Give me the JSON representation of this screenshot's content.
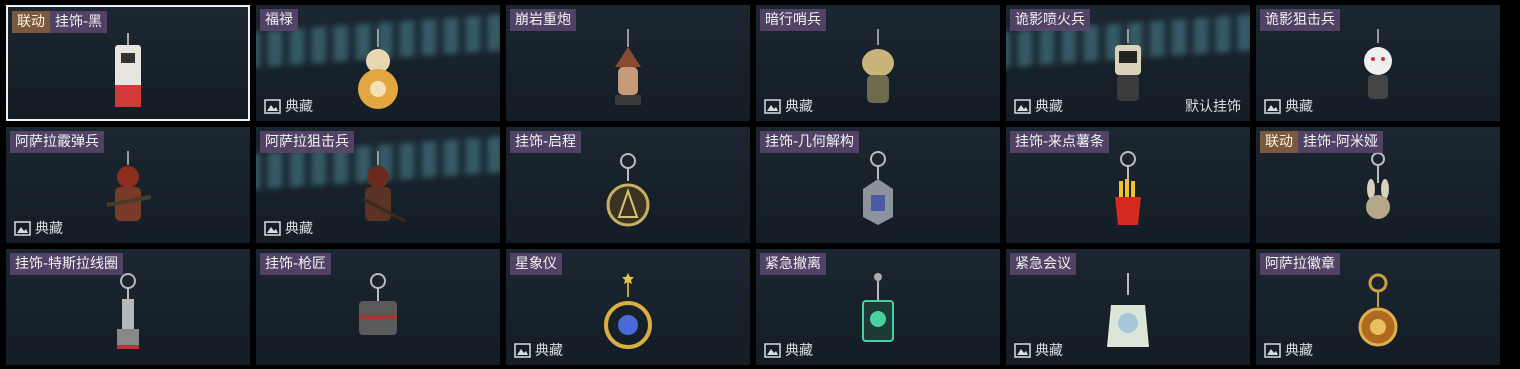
{
  "items": [
    {
      "collab": "联动",
      "name": "挂饰-黑",
      "selected": true,
      "icon": "black-charm-icon"
    },
    {
      "name": "福禄",
      "rarity": "典藏",
      "streak": true,
      "icon": "round-robot-charm-icon"
    },
    {
      "name": "崩岩重炮",
      "icon": "helmet-figure-charm-icon"
    },
    {
      "name": "暗行哨兵",
      "rarity": "典藏",
      "icon": "camo-figure-charm-icon"
    },
    {
      "name": "诡影喷火兵",
      "rarity": "典藏",
      "default_label": "默认挂饰",
      "streak": true,
      "icon": "flamethrower-figure-charm-icon"
    },
    {
      "name": "诡影狙击兵",
      "rarity": "典藏",
      "icon": "mask-figure-charm-icon"
    },
    {
      "name": "阿萨拉霰弹兵",
      "rarity": "典藏",
      "icon": "shotgunner-figure-charm-icon"
    },
    {
      "name": "阿萨拉狙击兵",
      "rarity": "典藏",
      "streak": true,
      "icon": "sniper-figure-charm-icon"
    },
    {
      "name": "挂饰-启程",
      "icon": "compass-medal-charm-icon"
    },
    {
      "name": "挂饰-几何解构",
      "icon": "geometric-shield-charm-icon"
    },
    {
      "name": "挂饰-来点薯条",
      "icon": "fries-charm-icon"
    },
    {
      "collab": "联动",
      "name": "挂饰-阿米娅",
      "icon": "bunny-charm-icon"
    },
    {
      "name": "挂饰-特斯拉线圈",
      "icon": "tesla-coil-charm-icon"
    },
    {
      "name": "挂饰-枪匠",
      "icon": "toolbox-charm-icon"
    },
    {
      "name": "星象仪",
      "rarity": "典藏",
      "icon": "orrery-charm-icon"
    },
    {
      "name": "紧急撤离",
      "rarity": "典藏",
      "icon": "green-tag-charm-icon"
    },
    {
      "name": "紧急会议",
      "rarity": "典藏",
      "icon": "meeting-badge-charm-icon"
    },
    {
      "name": "阿萨拉徽章",
      "rarity": "典藏",
      "icon": "asala-badge-charm-icon"
    }
  ],
  "colors": {
    "card_bg": "#1b2630",
    "collab_tag": "#7a5a3e",
    "name_tag": "#5c486e",
    "selected_border": "#eef0f2"
  }
}
